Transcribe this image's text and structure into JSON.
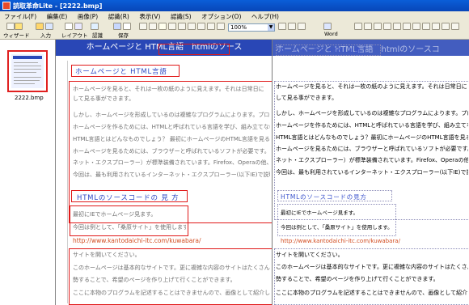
{
  "window": {
    "title": "読取革命Lite - [2222.bmp]"
  },
  "menu": {
    "items": [
      "ファイル(F)",
      "編集(E)",
      "画像(P)",
      "認識(R)",
      "表示(V)",
      "認識(S)",
      "オプション(O)",
      "ヘルプ(H)"
    ]
  },
  "toolbar": {
    "labels": [
      "ウィザード",
      "入力",
      "レイアウト",
      "認識",
      "保存",
      "Word"
    ],
    "zoom_value": "100%"
  },
  "sidebar": {
    "thumbnail_caption": "2222.bmp"
  },
  "document": {
    "header": "ホームページと HTML言語　htmlのソース",
    "heading1": "ホームページと HTML言語",
    "heading2": "HTMLのソースコードの 見 方",
    "left_paragraphs": [
      "ホームページを見ると、それは一枚の紙のように見えます。それは日常日に",
      "して見る事ができます。",
      "しかし、ホームページを形成しているのは複雑なプログラムによります。プログ",
      "ホームページを作るためには、HTMLと呼ばれている言語を学び、組み立てなけれ",
      "HTML言語とはどんなものでしょう？ 最初にホームページのHTML言語を見る方",
      "ホームページを見るためには、ブラウザーと呼ばれているソフトが必要です。ウ",
      "ネット・エクスプローラー）が標準装備されています。Firefox、Operaの他、数",
      "今回は、最も利用されているインターネット・エクスプローラー(以下IE)で説明"
    ],
    "left_section2": [
      "最初にIEでホームページ見ます。",
      "今回は例として、「桑原サイト」を使用します。"
    ],
    "link": "http://www.kantodaichi-itc.com/kuwabara/",
    "left_section3": [
      "サイトを開いてください。",
      "このホームページは基本的なサイトです。更に複雑な内容のサイトはたくさん",
      "勢することで、希望のページを作り上げて行くことができます。",
      "ここに本物のプログラムを記述することはできませんので、画像として紹介し"
    ],
    "right_header": "ホームページと HTML言語　htmlのソースコ",
    "right_heading1": "ホームページと HTML言語",
    "right_heading2": "HTMLのソースコードの見方",
    "right_paragraphs": [
      "ホームページを見ると、それは一枚の紙のように見えます。それは日常日にしているパソ",
      "して見る事ができます。",
      "しかし、ホームページを形成しているのは複雑なプログラムによります。プログラムは大",
      "ホームページを作るためには、HTMLと呼ばれている言語を学び、組み立てなければなりませ",
      "HTML言語とはどんなものでしょう？最初にホームページのHTML言語を見る方法を学びま",
      "ホームページを見るためには、ブラウザーと呼ばれているソフトが必要です。ウィンドウ",
      "ネット・エクスプローラー）が標準装備されています。Firefox、Operaの他、数種類があり",
      "今回は、最も利用されているインターネット・エクスプローラー(以下IE)で説明します。"
    ],
    "right_section2": [
      "最初にIEでホームページ見ます。",
      "今回は例として、「桑原サイト」を使用します。"
    ],
    "right_link": "http://www.kantodaichi-itc.com/kuwabara/",
    "right_section3": [
      "サイトを開いてください。",
      "このホームページは基本的なサイトです。更に複雑な内容のサイトはたくさんあります",
      "勢することで、希望のページを作り上げて行くことができます。",
      "ここに本物のプログラムを記述することはできませんので、画像として紹介します。"
    ]
  },
  "colors": {
    "header_blue": "#2947b6",
    "selection_red": "#e01818",
    "heading_blue": "#2e49c4",
    "link_orange": "#d24c20"
  }
}
